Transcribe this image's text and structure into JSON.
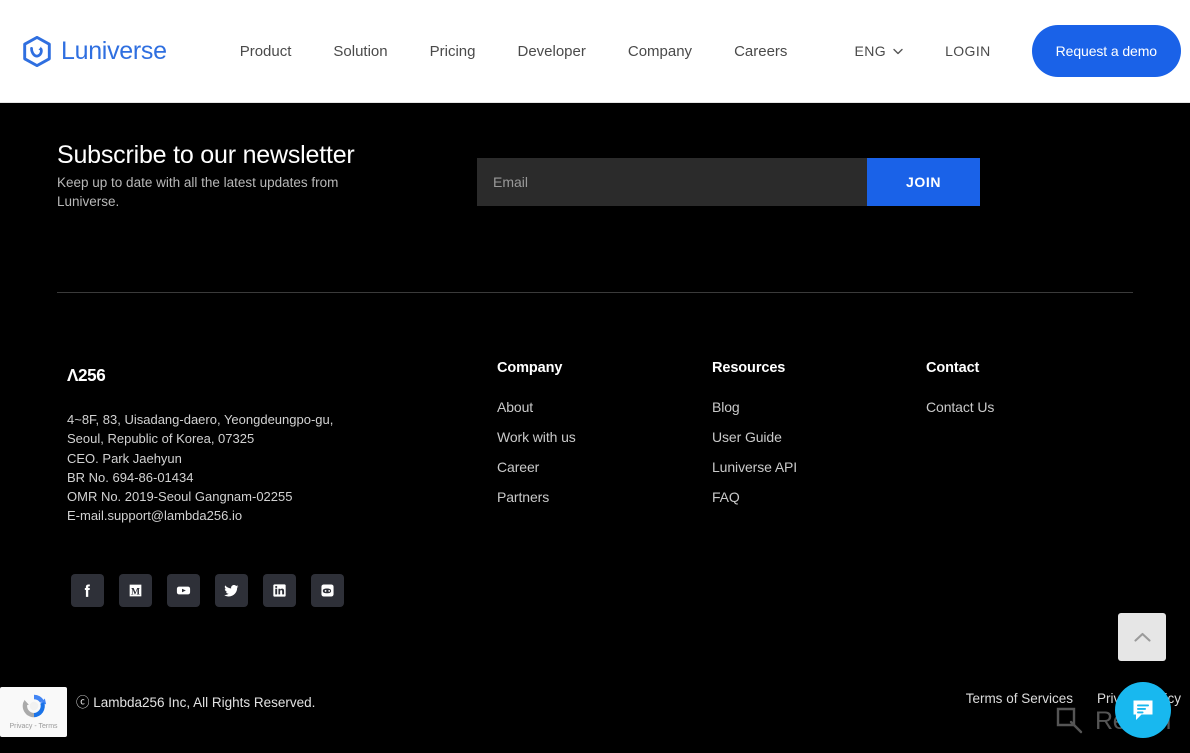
{
  "header": {
    "brand": "Luniverse",
    "nav": [
      {
        "label": "Product"
      },
      {
        "label": "Solution"
      },
      {
        "label": "Pricing"
      },
      {
        "label": "Developer"
      },
      {
        "label": "Company"
      },
      {
        "label": "Careers"
      }
    ],
    "language": "ENG",
    "login": "LOGIN",
    "demo_button": "Request a demo",
    "accent_color": "#1a62e8",
    "background": "#ffffff"
  },
  "newsletter": {
    "title": "Subscribe to our newsletter",
    "subtitle": "Keep up to date with all the latest updates from Luniverse.",
    "email_placeholder": "Email",
    "email_value": "",
    "join_label": "JOIN",
    "join_color": "#1a62e8",
    "input_background": "#2b2b2b"
  },
  "footer": {
    "company_logo": "Λ256",
    "address": "4~8F, 83, Uisadang-daero, Yeongdeungpo-gu,\nSeoul, Republic of Korea, 07325\nCEO. Park Jaehyun\nBR No. 694-86-01434\nOMR No. 2019-Seoul Gangnam-02255\nE-mail.support@lambda256.io",
    "columns": [
      {
        "heading": "Company",
        "links": [
          {
            "label": "About"
          },
          {
            "label": "Work with us"
          },
          {
            "label": "Career"
          },
          {
            "label": "Partners"
          }
        ]
      },
      {
        "heading": "Resources",
        "links": [
          {
            "label": "Blog"
          },
          {
            "label": "User Guide"
          },
          {
            "label": "Luniverse API"
          },
          {
            "label": "FAQ"
          }
        ]
      },
      {
        "heading": "Contact",
        "links": [
          {
            "label": "Contact Us"
          }
        ]
      }
    ],
    "socials": [
      {
        "name": "facebook-icon"
      },
      {
        "name": "medium-icon"
      },
      {
        "name": "youtube-icon"
      },
      {
        "name": "twitter-icon"
      },
      {
        "name": "linkedin-icon"
      },
      {
        "name": "discord-icon"
      }
    ],
    "copyright": "ⓒ Lambda256 Inc, All Rights Reserved.",
    "bottom_links": [
      {
        "label": "Terms of Services"
      },
      {
        "label": "Privacy Policy"
      }
    ],
    "background": "#000000"
  },
  "widgets": {
    "recaptcha_label": "Privacy - Terms",
    "watermark_text": "Revain",
    "chat_color": "#18b8ef",
    "scrolltop_color": "#e6e6e6"
  }
}
